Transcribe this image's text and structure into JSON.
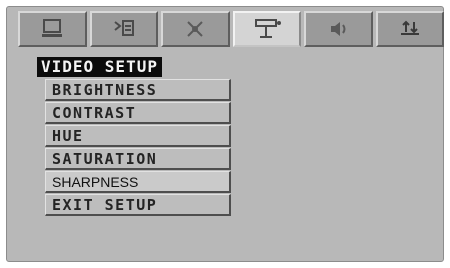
{
  "tabs": [
    {
      "icon": "monitor-icon",
      "active": false
    },
    {
      "icon": "language-icon",
      "active": false
    },
    {
      "icon": "audio-tools-icon",
      "active": false
    },
    {
      "icon": "video-setup-icon",
      "active": true
    },
    {
      "icon": "speaker-icon",
      "active": false
    },
    {
      "icon": "preference-icon",
      "active": false
    }
  ],
  "menu": {
    "title": "VIDEO SETUP",
    "items": [
      {
        "label": "BRIGHTNESS"
      },
      {
        "label": "CONTRAST"
      },
      {
        "label": "HUE"
      },
      {
        "label": "SATURATION"
      },
      {
        "label": "SHARPNESS",
        "selected": true
      },
      {
        "label": "EXIT SETUP"
      }
    ]
  },
  "colors": {
    "background": "#b8b8b8",
    "tab": "#9a9a9a",
    "tab_active": "#d4d4d4",
    "title_bg": "#0c0c0c",
    "title_text": "#f4f4f4",
    "item_bg": "#bdbdbd",
    "item_text": "#242424"
  }
}
